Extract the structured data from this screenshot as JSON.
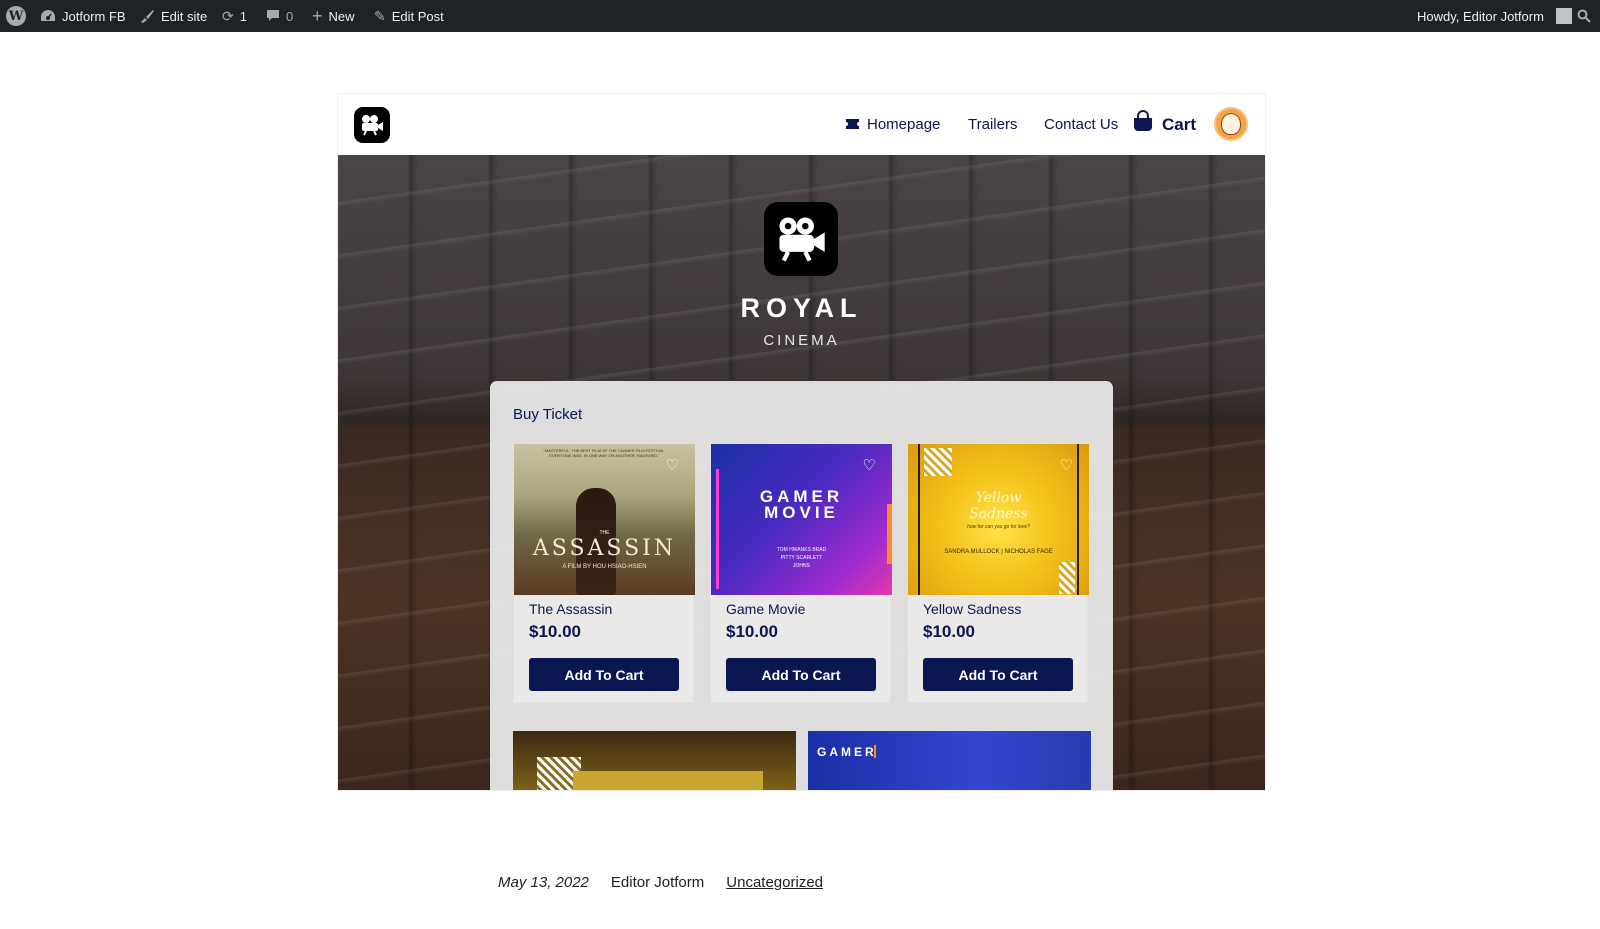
{
  "adminbar": {
    "site_name": "Jotform FB",
    "edit_site": "Edit site",
    "updates_count": "1",
    "comments_count": "0",
    "new_label": "New",
    "edit_post": "Edit Post",
    "howdy": "Howdy, Editor Jotform"
  },
  "nav": {
    "items": [
      "Homepage",
      "Trailers",
      "Contact Us"
    ],
    "cart": "Cart"
  },
  "hero": {
    "title": "ROYAL",
    "subtitle": "CINEMA"
  },
  "form": {
    "title": "Buy Ticket",
    "products": [
      {
        "name": "The Assassin",
        "price": "$10.00",
        "button": "Add To Cart",
        "poster_title": "ASSASSIN",
        "poster_small": "THE",
        "poster_tag": "\"MASTERFUL. THE BEST FILM OF THE CANNES FILM FESTIVAL. EVERYONE WAS, IN ONE WAY OR ANOTHER, RAVISHED.\"",
        "poster_credit": "A FILM BY HOU HSIAO-HSIEN"
      },
      {
        "name": "Game Movie",
        "price": "$10.00",
        "button": "Add To Cart",
        "poster_title": "GAMER MOVIE",
        "poster_cast": "TOM HWANKS BRAD PITTY SCARLETT JOHNS"
      },
      {
        "name": "Yellow Sadness",
        "price": "$10.00",
        "button": "Add To Cart",
        "poster_title": "Yellow Sadness",
        "poster_tagline": "how far can you go for love?",
        "poster_cast": "SANDRA MULLOCK | NICHOLAS FAGE"
      }
    ],
    "row2_poster_label": "GAMER"
  },
  "post_meta": {
    "date": "May 13, 2022",
    "author": "Editor Jotform",
    "category": "Uncategorized"
  },
  "icons": {
    "wordpress": "wordpress-icon",
    "dashboard": "dashboard-icon",
    "brush": "brush-icon",
    "updates": "refresh-icon",
    "comments": "comment-icon",
    "plus": "plus-icon",
    "pencil": "pencil-icon",
    "search": "search-icon",
    "camera": "movie-camera-icon",
    "ticket": "ticket-icon",
    "basket": "basket-icon",
    "heart": "heart-icon"
  },
  "colors": {
    "adminbar_bg": "#1d2327",
    "navy": "#0a1551",
    "button_bg": "#0a1551"
  }
}
